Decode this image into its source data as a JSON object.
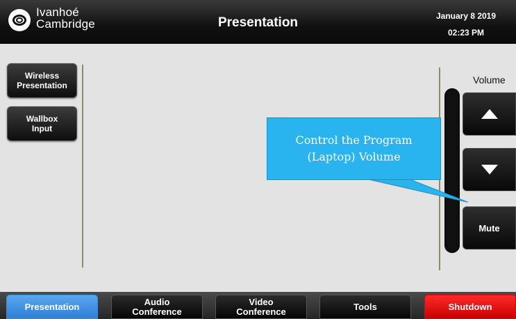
{
  "header": {
    "logo_line1": "Ivanhoé",
    "logo_line2": "Cambridge",
    "title": "Presentation",
    "date": "January 8 2019",
    "time": "02:23 PM"
  },
  "sources": [
    {
      "line1": "Wireless",
      "line2": "Presentation"
    },
    {
      "line1": "Wallbox",
      "line2": "Input"
    }
  ],
  "volume": {
    "label": "Volume",
    "up_icon": "triangle-up-icon",
    "down_icon": "triangle-down-icon",
    "mute_label": "Mute"
  },
  "callout": {
    "line1": "Control the Program",
    "line2": "(Laptop) Volume",
    "color": "#29b4f0"
  },
  "tabs": [
    {
      "line1": "Presentation",
      "line2": "",
      "active": true
    },
    {
      "line1": "Audio",
      "line2": "Conference",
      "active": false
    },
    {
      "line1": "Video",
      "line2": "Conference",
      "active": false
    },
    {
      "line1": "Tools",
      "line2": "",
      "active": false
    },
    {
      "line1": "Shutdown",
      "line2": "",
      "active": false
    }
  ],
  "colors": {
    "active_tab": "#3a8ee0",
    "shutdown": "#e00000",
    "background": "#e3e3e3"
  }
}
